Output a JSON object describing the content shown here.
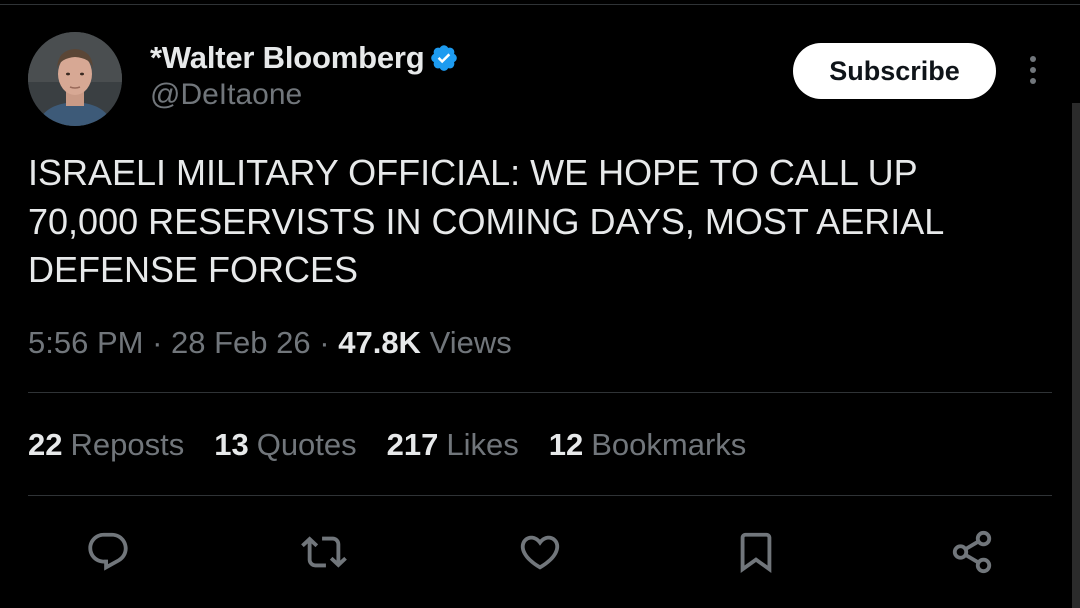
{
  "author": {
    "display_name": "*Walter Bloomberg",
    "handle": "@DeItaone",
    "verified": true
  },
  "header": {
    "subscribe_label": "Subscribe"
  },
  "tweet": {
    "text": "ISRAELI MILITARY OFFICIAL: WE HOPE TO CALL UP 70,000 RESERVISTS IN COMING DAYS, MOST AERIAL DEFENSE FORCES",
    "time": "5:56 PM",
    "date": "28 Feb 26",
    "views_count": "47.8K",
    "views_label": "Views",
    "separator": "·"
  },
  "stats": [
    {
      "count": "22",
      "label": "Reposts"
    },
    {
      "count": "13",
      "label": "Quotes"
    },
    {
      "count": "217",
      "label": "Likes"
    },
    {
      "count": "12",
      "label": "Bookmarks"
    }
  ],
  "actions": [
    "reply-icon",
    "repost-icon",
    "like-icon",
    "bookmark-icon",
    "share-icon"
  ],
  "colors": {
    "background": "#000000",
    "primary_text": "#e7e9ea",
    "secondary_text": "#71767b",
    "verified_blue": "#1d9bf0",
    "divider": "#2f3336"
  }
}
